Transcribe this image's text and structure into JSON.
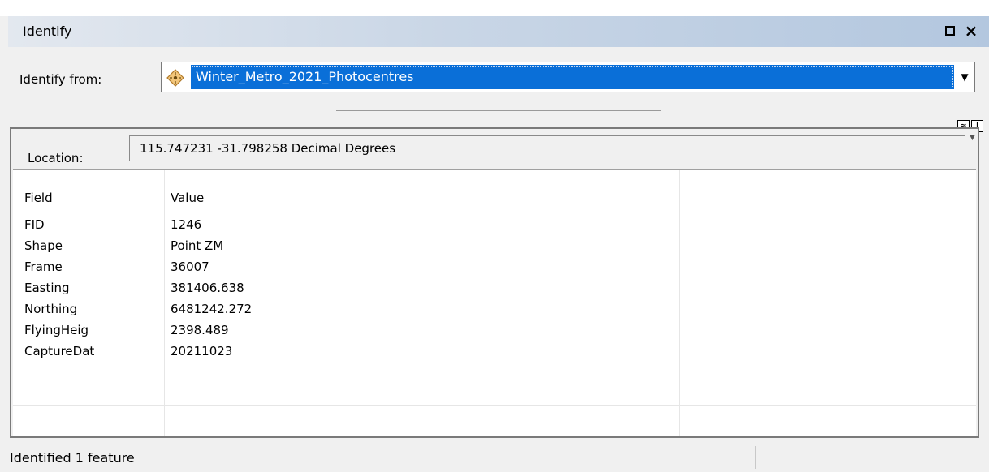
{
  "window": {
    "title": "Identify",
    "restore_icon": "restore-icon",
    "close_icon": "close-icon",
    "close_glyph": "×"
  },
  "identify_from": {
    "label": "Identify from:",
    "selected": "Winter_Metro_2021_Photocentres",
    "layer_icon": "point-layer-icon",
    "arrow_glyph": "▼"
  },
  "location": {
    "label": "Location:",
    "value": "115.747231  -31.798258 Decimal Degrees"
  },
  "table": {
    "headers": [
      "Field",
      "Value"
    ],
    "rows": [
      {
        "field": "FID",
        "value": "1246"
      },
      {
        "field": "Shape",
        "value": "Point ZM"
      },
      {
        "field": "Frame",
        "value": "36007"
      },
      {
        "field": "Easting",
        "value": "381406.638"
      },
      {
        "field": "Northing",
        "value": "6481242.272"
      },
      {
        "field": "FlyingHeig",
        "value": "2398.489"
      },
      {
        "field": "CaptureDat",
        "value": "20211023"
      }
    ]
  },
  "status": {
    "text": "Identified 1 feature"
  },
  "colors": {
    "selection": "#0a6fd8",
    "title_gradient_end": "#b3c7df",
    "layer_icon_fill": "#f2c57a"
  }
}
